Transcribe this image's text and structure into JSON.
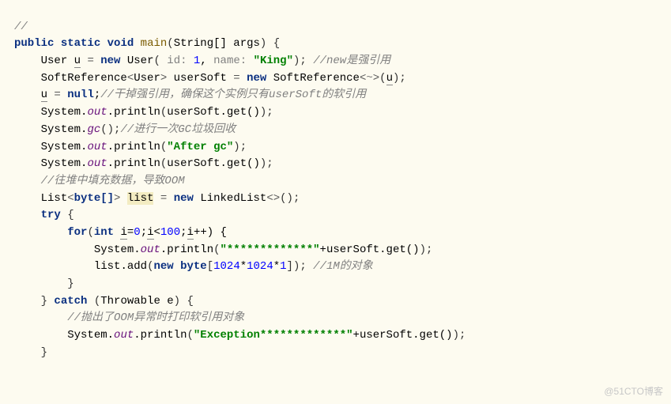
{
  "code": {
    "l1_comment": "//",
    "l2_kw_public": "public",
    "l2_kw_static": "static",
    "l2_kw_void": "void",
    "l2_main": "main",
    "l2_paramtype": "String[] args",
    "l3_type_user": "User",
    "l3_var_u": "u",
    "l3_kw_new": "new",
    "l3_user_ctor": "User",
    "l3_hint_id": "id:",
    "l3_id_val": "1",
    "l3_hint_name": "name:",
    "l3_name_val": "\"King\"",
    "l3_comment": "//new是强引用",
    "l4_type_softref": "SoftReference",
    "l4_var_usersoft": "userSoft",
    "l4_kw_new": "new",
    "l4_ctor_softref": "SoftReference",
    "l4_tilde": "~",
    "l4_arg_u": "u",
    "l5_var_u2": "u",
    "l5_kw_null": "null",
    "l5_comment": "//干掉强引用，确保这个实例只有userSoft的软引用",
    "l6_system": "System",
    "l6_out": "out",
    "l6_println": "println",
    "l6_arg": "userSoft.get()",
    "l7_system": "System",
    "l7_gc": "gc",
    "l7_comment": "//进行一次GC垃圾回收",
    "l8_system": "System",
    "l8_out": "out",
    "l8_println": "println",
    "l8_str": "\"After gc\"",
    "l9_system": "System",
    "l9_out": "out",
    "l9_println": "println",
    "l9_arg": "userSoft.get()",
    "l10_comment": "//往堆中填充数据，导致OOM",
    "l11_list_type": "List",
    "l11_byte_arr": "byte[]",
    "l11_list_var": "list",
    "l11_kw_new": "new",
    "l11_linked": "LinkedList",
    "l12_kw_try": "try",
    "l13_kw_for": "for",
    "l13_kw_int": "int",
    "l13_i1": "i",
    "l13_zero": "0",
    "l13_i2": "i",
    "l13_hundred": "100",
    "l13_i3": "i",
    "l14_system": "System",
    "l14_out": "out",
    "l14_println": "println",
    "l14_str": "\"*************\"",
    "l14_arg2": "userSoft.get()",
    "l15_list": "list",
    "l15_add": "add",
    "l15_kw_new": "new",
    "l15_kw_byte": "byte",
    "l15_1024a": "1024",
    "l15_1024b": "1024",
    "l15_1": "1",
    "l15_comment": "//1M的对象",
    "l17_kw_catch": "catch",
    "l17_throwable": "Throwable e",
    "l18_comment": "//抛出了OOM异常时打印软引用对象",
    "l19_system": "System",
    "l19_out": "out",
    "l19_println": "println",
    "l19_str": "\"Exception*************\"",
    "l19_arg2": "userSoft.get()"
  },
  "watermark": "@51CTO博客"
}
